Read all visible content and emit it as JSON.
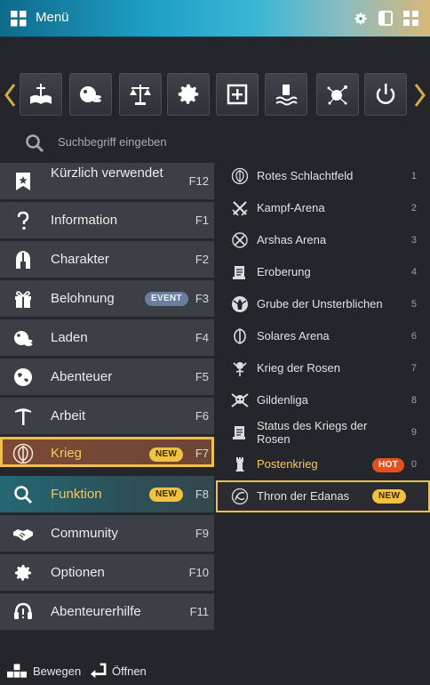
{
  "window": {
    "title": "Menü"
  },
  "quickbar": {
    "icons": [
      "book-sword-icon",
      "shop-bag-icon",
      "scales-icon",
      "gear-icon",
      "expand-box-icon",
      "water-hand-icon",
      "network-node-icon",
      "power-icon"
    ]
  },
  "search": {
    "placeholder": "Suchbegriff eingeben"
  },
  "left_menu": [
    {
      "label": "Kürzlich verwendet",
      "key": "F12",
      "icon": "bookmark-star-icon"
    },
    {
      "label": "Information",
      "key": "F1",
      "icon": "question-icon"
    },
    {
      "label": "Charakter",
      "key": "F2",
      "icon": "helmet-icon"
    },
    {
      "label": "Belohnung",
      "key": "F3",
      "icon": "gift-icon",
      "badge": "EVENT"
    },
    {
      "label": "Laden",
      "key": "F4",
      "icon": "shop-bag-icon"
    },
    {
      "label": "Abenteuer",
      "key": "F5",
      "icon": "globe-icon"
    },
    {
      "label": "Arbeit",
      "key": "F6",
      "icon": "pickaxe-icon"
    },
    {
      "label": "Krieg",
      "key": "F7",
      "icon": "war-shield-icon",
      "badge": "NEW"
    },
    {
      "label": "Funktion",
      "key": "F8",
      "icon": "search-icon",
      "badge": "NEW"
    },
    {
      "label": "Community",
      "key": "F9",
      "icon": "handshake-icon"
    },
    {
      "label": "Optionen",
      "key": "F10",
      "icon": "gear-icon"
    },
    {
      "label": "Abenteurerhilfe",
      "key": "F11",
      "icon": "headset-icon"
    }
  ],
  "right_menu": [
    {
      "label": "Rotes Schlachtfeld",
      "num": "1",
      "icon": "shield-emblem-icon"
    },
    {
      "label": "Kampf-Arena",
      "num": "2",
      "icon": "crossed-swords-icon"
    },
    {
      "label": "Arshas Arena",
      "num": "3",
      "icon": "crossed-circle-icon"
    },
    {
      "label": "Eroberung",
      "num": "4",
      "icon": "scroll-icon"
    },
    {
      "label": "Grube der Unsterblichen",
      "num": "5",
      "icon": "demon-icon"
    },
    {
      "label": "Solares Arena",
      "num": "6",
      "icon": "solar-shield-icon"
    },
    {
      "label": "Krieg der Rosen",
      "num": "7",
      "icon": "rose-emblem-icon"
    },
    {
      "label": "Gildenliga",
      "num": "8",
      "icon": "guild-skull-icon"
    },
    {
      "label": "Status des Kriegs der Rosen",
      "num": "9",
      "icon": "scroll-icon"
    },
    {
      "label": "Postenkrieg",
      "num": "0",
      "icon": "tower-icon",
      "badge": "HOT"
    },
    {
      "label": "Thron der Edanas",
      "icon": "edana-icon",
      "badge": "NEW"
    }
  ],
  "footer": {
    "move": "Bewegen",
    "open": "Öffnen"
  },
  "colors": {
    "accent": "#f0c04a",
    "badge_new": "#f1c23f",
    "badge_hot": "#e0531e",
    "badge_event": "#6a7f9d"
  }
}
